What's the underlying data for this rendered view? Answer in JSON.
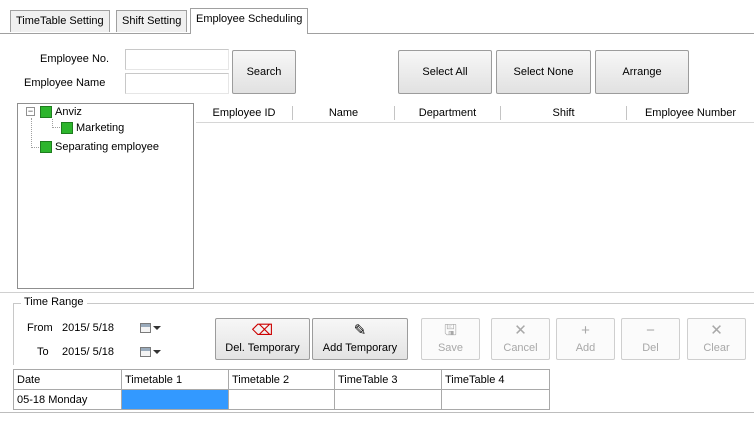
{
  "tabs": [
    {
      "label": "TimeTable Setting"
    },
    {
      "label": "Shift Setting"
    },
    {
      "label": "Employee Scheduling",
      "active": true
    }
  ],
  "filter": {
    "employee_no_label": "Employee No.",
    "employee_no_value": "",
    "employee_name_label": "Employee Name",
    "employee_name_value": "",
    "search_label": "Search"
  },
  "actions": {
    "select_all": "Select All",
    "select_none": "Select None",
    "arrange": "Arrange"
  },
  "tree": {
    "root": "Anviz",
    "child": "Marketing",
    "other": "Separating employee"
  },
  "grid": {
    "columns": [
      "Employee ID",
      "Name",
      "Department",
      "Shift",
      "Employee Number"
    ],
    "rows": []
  },
  "time_range": {
    "title": "Time Range",
    "from_label": "From",
    "from_value": "2015/ 5/18",
    "to_label": "To",
    "to_value": "2015/ 5/18"
  },
  "toolbar": {
    "del_temporary": "Del. Temporary",
    "add_temporary": "Add Temporary",
    "save": "Save",
    "cancel": "Cancel",
    "add": "Add",
    "del": "Del",
    "clear": "Clear"
  },
  "timetable": {
    "headers": [
      "Date",
      "Timetable 1",
      "Timetable 2",
      "TimeTable 3",
      "TimeTable 4"
    ],
    "rows": [
      {
        "date": "05-18 Monday",
        "t1": "",
        "t2": "",
        "t3": "",
        "t4": ""
      }
    ]
  },
  "colors": {
    "selection": "#3399ff",
    "tree_node": "#2db52d"
  }
}
